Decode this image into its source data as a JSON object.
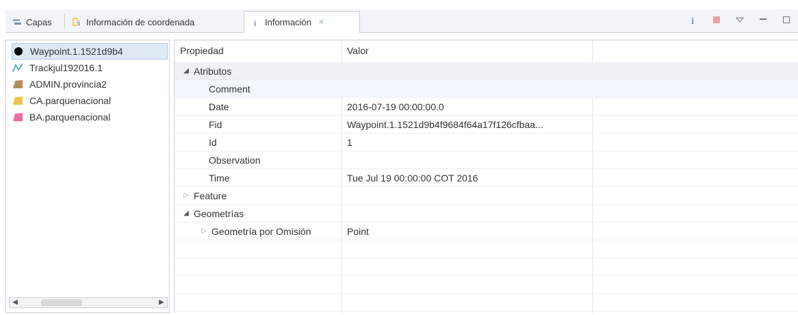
{
  "tabs": [
    {
      "label": "Capas",
      "icon": "layers-icon"
    },
    {
      "label": "Información de coordenada",
      "icon": "coordinate-info-icon"
    },
    {
      "label": "Información",
      "icon": "info-icon",
      "close": "✕"
    }
  ],
  "toolbar": {
    "icons": [
      "info-icon",
      "stop-icon",
      "view-menu-icon",
      "minimize-icon",
      "maximize-icon"
    ]
  },
  "layers": [
    {
      "label": "Waypoint.1.1521d9b4",
      "icon": "point-layer-icon",
      "color": "#000000"
    },
    {
      "label": "Trackjul192016.1",
      "icon": "line-layer-icon",
      "color": "#2aa198"
    },
    {
      "label": "ADMIN.provincia2",
      "icon": "polygon-layer-icon",
      "color": "#b08d57"
    },
    {
      "label": "CA.parquenacional",
      "icon": "polygon-layer-icon",
      "color": "#f2c14e"
    },
    {
      "label": "BA.parquenacional",
      "icon": "polygon-layer-icon",
      "color": "#f06aa8"
    }
  ],
  "scroll": {
    "left": "◀",
    "right": "▶",
    "thumb": "III"
  },
  "table": {
    "headers": {
      "property": "Propiedad",
      "value": "Valor"
    },
    "rows": [
      {
        "property": "Atributos",
        "value": "",
        "level": 0,
        "toggle": "expanded"
      },
      {
        "property": "Comment",
        "value": "",
        "level": 1
      },
      {
        "property": "Date",
        "value": "2016-07-19 00:00:00.0",
        "level": 1
      },
      {
        "property": "Fid",
        "value": "Waypoint.1.1521d9b4f9684f64a17f126cfbaa...",
        "level": 1
      },
      {
        "property": "Id",
        "value": "1",
        "level": 1
      },
      {
        "property": "Observation",
        "value": "",
        "level": 1
      },
      {
        "property": "Time",
        "value": "Tue Jul 19 00:00:00 COT 2016",
        "level": 1
      },
      {
        "property": "Feature",
        "value": "",
        "level": 0,
        "toggle": "collapsed"
      },
      {
        "property": "Geometrías",
        "value": "",
        "level": 0,
        "toggle": "expanded"
      },
      {
        "property": "Geometría por Omisión",
        "value": "Point",
        "level": 1,
        "toggle": "collapsed"
      }
    ]
  }
}
